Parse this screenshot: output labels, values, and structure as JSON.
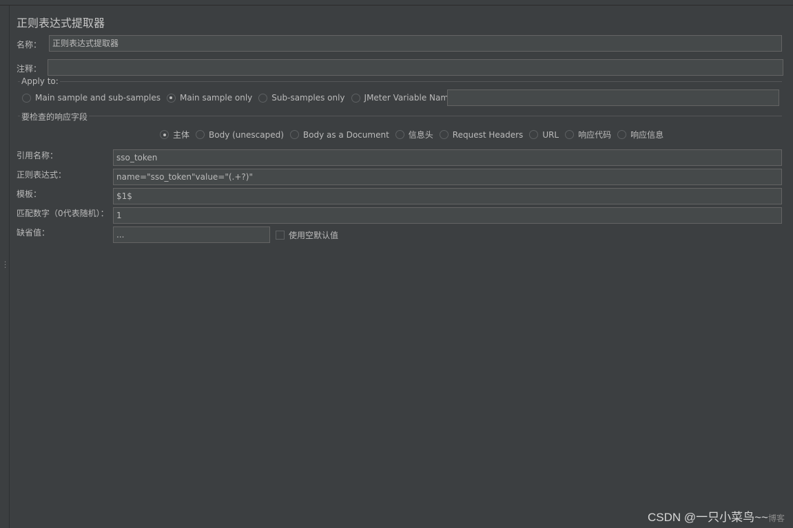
{
  "title": "正则表达式提取器",
  "name_label": "名称：",
  "name_value": "正则表达式提取器",
  "comment_label": "注释：",
  "comment_value": "",
  "apply_to": {
    "legend": "Apply to:",
    "options": [
      "Main sample and sub-samples",
      "Main sample only",
      "Sub-samples only",
      "JMeter Variable Name to use"
    ],
    "selected": 1,
    "variable_value": ""
  },
  "field_check": {
    "legend": "要检查的响应字段",
    "options": [
      "主体",
      "Body (unescaped)",
      "Body as a Document",
      "信息头",
      "Request Headers",
      "URL",
      "响应代码",
      "响应信息"
    ],
    "selected": 0
  },
  "fields": [
    {
      "label": "引用名称：",
      "value": "sso_token"
    },
    {
      "label": "正则表达式：",
      "value": "name=\"sso_token\"value=\"(.+?)\""
    },
    {
      "label": "模板：",
      "value": "$1$"
    },
    {
      "label": "匹配数字（0代表随机）：",
      "value": "1"
    }
  ],
  "default": {
    "label": "缺省值：",
    "value": "...",
    "checkbox_label": "使用空默认值",
    "checked": false
  },
  "watermark": {
    "text": "CSDN @一只小菜鸟~~",
    "faint": "博客"
  }
}
